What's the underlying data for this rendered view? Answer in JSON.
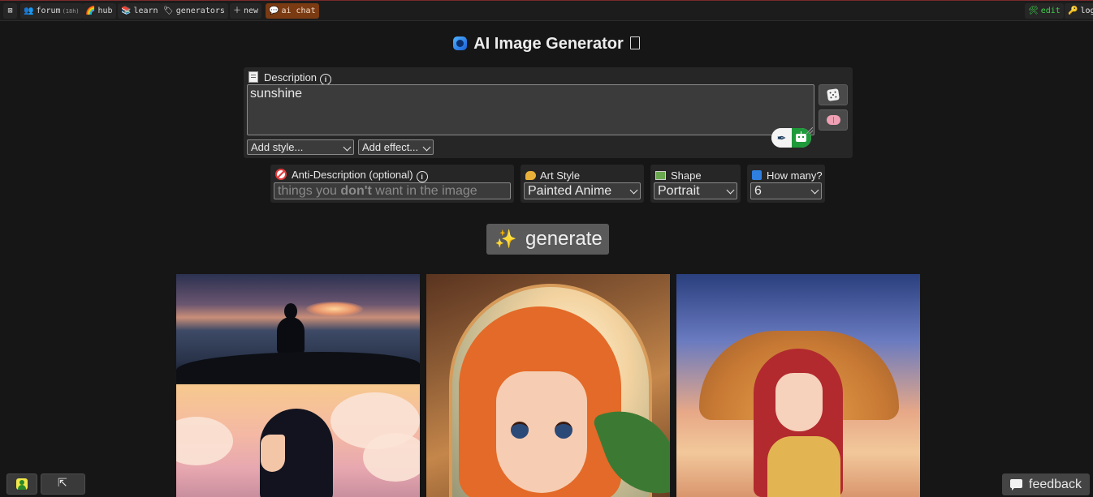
{
  "nav": {
    "close_glyph": "⊠",
    "forum_label": "forum",
    "forum_badge": "(18h)",
    "hub_label": "hub",
    "learn_label": "learn",
    "generators_label": "generators",
    "new_label": "new",
    "ai_chat_label": "ai chat",
    "edit_label": "edit",
    "login_label": "log"
  },
  "page": {
    "title": "AI Image Generator"
  },
  "description": {
    "label": "Description",
    "value": "sunshine",
    "style_select": "Add style...",
    "effect_select": "Add effect..."
  },
  "anti_description": {
    "label": "Anti-Description (optional)",
    "placeholder_prefix": "things you ",
    "placeholder_bold": "don't",
    "placeholder_suffix": " want in the image"
  },
  "art_style": {
    "label": "Art Style",
    "selected": "Painted Anime"
  },
  "shape": {
    "label": "Shape",
    "selected": "Portrait"
  },
  "how_many": {
    "label": "How many?",
    "selected": "6"
  },
  "generate": {
    "label": "generate"
  },
  "feedback": {
    "label": "feedback"
  },
  "icons": {
    "close": "close-icon",
    "forum": "people-icon",
    "hub": "rainbow-icon",
    "learn": "books-icon",
    "generators": "tag-icon",
    "new": "plus-icon",
    "ai_chat": "chat-icon",
    "edit": "tools-icon",
    "login": "key-icon",
    "dice": "dice-icon",
    "brain": "brain-icon",
    "sparkle": "sparkle-icon"
  },
  "colors": {
    "background": "#161616",
    "panel": "#262626",
    "active_tab": "#7a3a12",
    "edit_green": "#3fd24a",
    "generate_button": "#5a5a5a"
  }
}
